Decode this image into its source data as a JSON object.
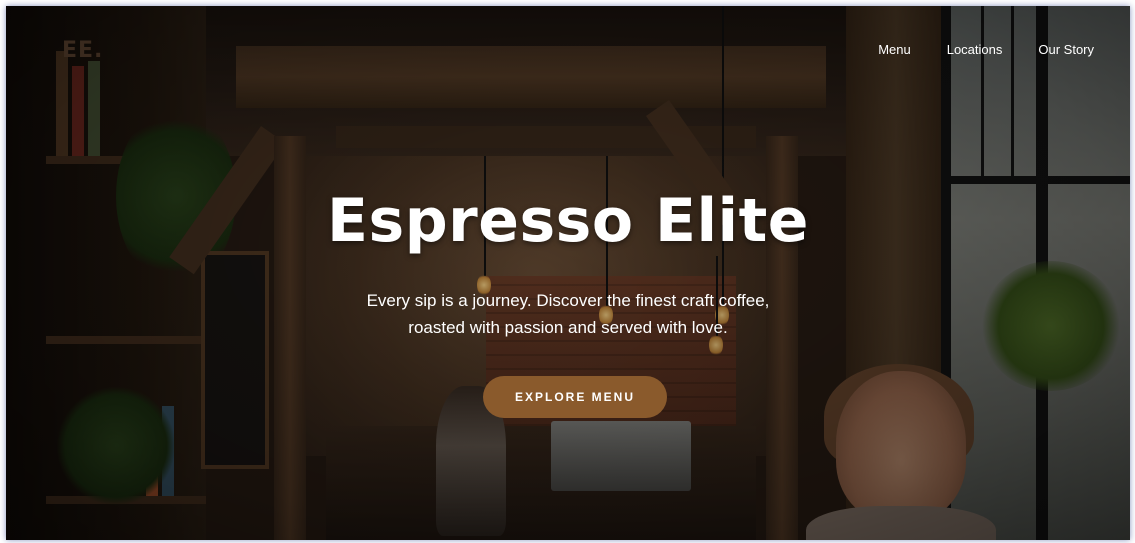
{
  "brand": {
    "logo_text": "EE."
  },
  "nav": {
    "items": [
      {
        "label": "Menu"
      },
      {
        "label": "Locations"
      },
      {
        "label": "Our Story"
      }
    ]
  },
  "hero": {
    "title": "Espresso Elite",
    "subtitle_line1": "Every sip is a journey. Discover the finest craft coffee,",
    "subtitle_line2": "roasted with passion and served with love.",
    "cta_label": "EXPLORE MENU"
  },
  "colors": {
    "accent": "#8a5a2c",
    "text": "#ffffff",
    "logo": "#3a2a1e"
  }
}
